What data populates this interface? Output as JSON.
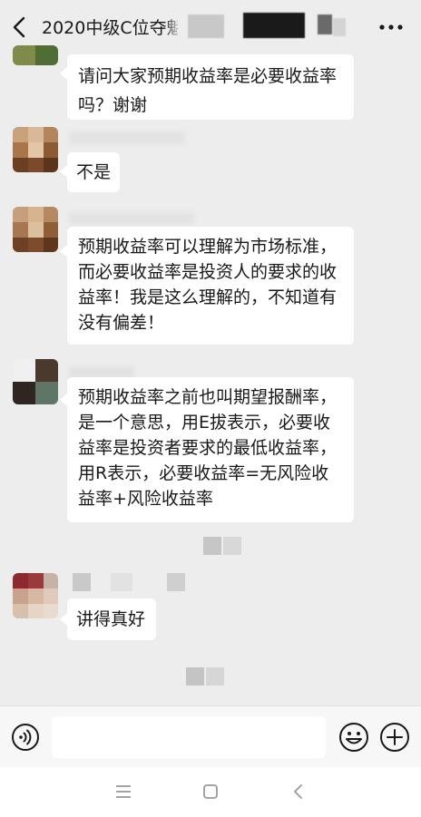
{
  "header": {
    "title": "2020中级C位夺魁",
    "back_icon": "chevron-left-icon",
    "more_icon": "more-horizontal-icon"
  },
  "messages": [
    {
      "text": "请问大家预期收益率是必要收益率吗？谢谢"
    },
    {
      "text": "不是"
    },
    {
      "text": "预期收益率可以理解为市场标准，而必要收益率是投资人的要求的收益率！我是这么理解的，不知道有没有偏差！"
    },
    {
      "text": "预期收益率之前也叫期望报酬率，是一个意思，用E拔表示，必要收益率是投资者要求的最低收益率，用R表示，必要收益率=无风险收益率+风险收益率"
    },
    {
      "text": "讲得真好"
    }
  ],
  "input_bar": {
    "voice_icon": "voice-icon",
    "input_value": "",
    "input_placeholder": "",
    "emoji_icon": "emoji-icon",
    "plus_icon": "plus-icon"
  },
  "nav_bar": {
    "menu_icon": "menu-icon",
    "home_icon": "home-square-icon",
    "back_icon": "back-arrow-icon"
  },
  "colors": {
    "background": "#ededed",
    "bubble": "#ffffff",
    "text": "#191919"
  }
}
